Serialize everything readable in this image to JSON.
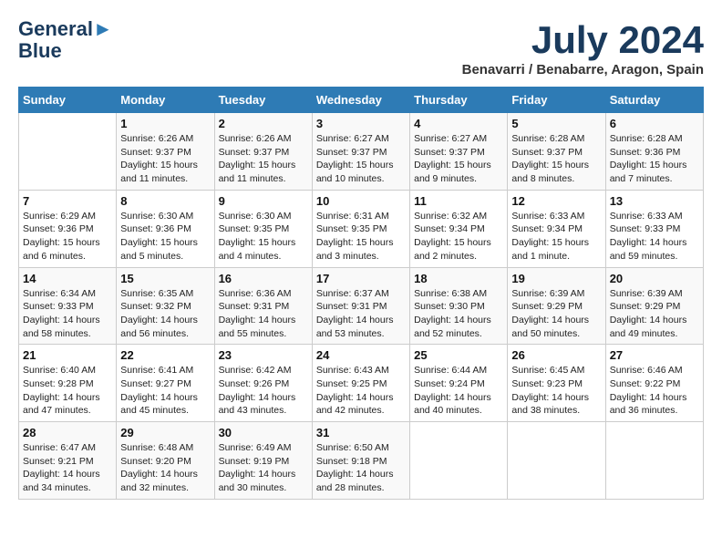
{
  "header": {
    "logo_line1": "General",
    "logo_line2": "Blue",
    "month_title": "July 2024",
    "subtitle": "Benavarri / Benabarre, Aragon, Spain"
  },
  "days_of_week": [
    "Sunday",
    "Monday",
    "Tuesday",
    "Wednesday",
    "Thursday",
    "Friday",
    "Saturday"
  ],
  "weeks": [
    [
      {
        "day": "",
        "sunrise": "",
        "sunset": "",
        "daylight": ""
      },
      {
        "day": "1",
        "sunrise": "Sunrise: 6:26 AM",
        "sunset": "Sunset: 9:37 PM",
        "daylight": "Daylight: 15 hours and 11 minutes."
      },
      {
        "day": "2",
        "sunrise": "Sunrise: 6:26 AM",
        "sunset": "Sunset: 9:37 PM",
        "daylight": "Daylight: 15 hours and 11 minutes."
      },
      {
        "day": "3",
        "sunrise": "Sunrise: 6:27 AM",
        "sunset": "Sunset: 9:37 PM",
        "daylight": "Daylight: 15 hours and 10 minutes."
      },
      {
        "day": "4",
        "sunrise": "Sunrise: 6:27 AM",
        "sunset": "Sunset: 9:37 PM",
        "daylight": "Daylight: 15 hours and 9 minutes."
      },
      {
        "day": "5",
        "sunrise": "Sunrise: 6:28 AM",
        "sunset": "Sunset: 9:37 PM",
        "daylight": "Daylight: 15 hours and 8 minutes."
      },
      {
        "day": "6",
        "sunrise": "Sunrise: 6:28 AM",
        "sunset": "Sunset: 9:36 PM",
        "daylight": "Daylight: 15 hours and 7 minutes."
      }
    ],
    [
      {
        "day": "7",
        "sunrise": "Sunrise: 6:29 AM",
        "sunset": "Sunset: 9:36 PM",
        "daylight": "Daylight: 15 hours and 6 minutes."
      },
      {
        "day": "8",
        "sunrise": "Sunrise: 6:30 AM",
        "sunset": "Sunset: 9:36 PM",
        "daylight": "Daylight: 15 hours and 5 minutes."
      },
      {
        "day": "9",
        "sunrise": "Sunrise: 6:30 AM",
        "sunset": "Sunset: 9:35 PM",
        "daylight": "Daylight: 15 hours and 4 minutes."
      },
      {
        "day": "10",
        "sunrise": "Sunrise: 6:31 AM",
        "sunset": "Sunset: 9:35 PM",
        "daylight": "Daylight: 15 hours and 3 minutes."
      },
      {
        "day": "11",
        "sunrise": "Sunrise: 6:32 AM",
        "sunset": "Sunset: 9:34 PM",
        "daylight": "Daylight: 15 hours and 2 minutes."
      },
      {
        "day": "12",
        "sunrise": "Sunrise: 6:33 AM",
        "sunset": "Sunset: 9:34 PM",
        "daylight": "Daylight: 15 hours and 1 minute."
      },
      {
        "day": "13",
        "sunrise": "Sunrise: 6:33 AM",
        "sunset": "Sunset: 9:33 PM",
        "daylight": "Daylight: 14 hours and 59 minutes."
      }
    ],
    [
      {
        "day": "14",
        "sunrise": "Sunrise: 6:34 AM",
        "sunset": "Sunset: 9:33 PM",
        "daylight": "Daylight: 14 hours and 58 minutes."
      },
      {
        "day": "15",
        "sunrise": "Sunrise: 6:35 AM",
        "sunset": "Sunset: 9:32 PM",
        "daylight": "Daylight: 14 hours and 56 minutes."
      },
      {
        "day": "16",
        "sunrise": "Sunrise: 6:36 AM",
        "sunset": "Sunset: 9:31 PM",
        "daylight": "Daylight: 14 hours and 55 minutes."
      },
      {
        "day": "17",
        "sunrise": "Sunrise: 6:37 AM",
        "sunset": "Sunset: 9:31 PM",
        "daylight": "Daylight: 14 hours and 53 minutes."
      },
      {
        "day": "18",
        "sunrise": "Sunrise: 6:38 AM",
        "sunset": "Sunset: 9:30 PM",
        "daylight": "Daylight: 14 hours and 52 minutes."
      },
      {
        "day": "19",
        "sunrise": "Sunrise: 6:39 AM",
        "sunset": "Sunset: 9:29 PM",
        "daylight": "Daylight: 14 hours and 50 minutes."
      },
      {
        "day": "20",
        "sunrise": "Sunrise: 6:39 AM",
        "sunset": "Sunset: 9:29 PM",
        "daylight": "Daylight: 14 hours and 49 minutes."
      }
    ],
    [
      {
        "day": "21",
        "sunrise": "Sunrise: 6:40 AM",
        "sunset": "Sunset: 9:28 PM",
        "daylight": "Daylight: 14 hours and 47 minutes."
      },
      {
        "day": "22",
        "sunrise": "Sunrise: 6:41 AM",
        "sunset": "Sunset: 9:27 PM",
        "daylight": "Daylight: 14 hours and 45 minutes."
      },
      {
        "day": "23",
        "sunrise": "Sunrise: 6:42 AM",
        "sunset": "Sunset: 9:26 PM",
        "daylight": "Daylight: 14 hours and 43 minutes."
      },
      {
        "day": "24",
        "sunrise": "Sunrise: 6:43 AM",
        "sunset": "Sunset: 9:25 PM",
        "daylight": "Daylight: 14 hours and 42 minutes."
      },
      {
        "day": "25",
        "sunrise": "Sunrise: 6:44 AM",
        "sunset": "Sunset: 9:24 PM",
        "daylight": "Daylight: 14 hours and 40 minutes."
      },
      {
        "day": "26",
        "sunrise": "Sunrise: 6:45 AM",
        "sunset": "Sunset: 9:23 PM",
        "daylight": "Daylight: 14 hours and 38 minutes."
      },
      {
        "day": "27",
        "sunrise": "Sunrise: 6:46 AM",
        "sunset": "Sunset: 9:22 PM",
        "daylight": "Daylight: 14 hours and 36 minutes."
      }
    ],
    [
      {
        "day": "28",
        "sunrise": "Sunrise: 6:47 AM",
        "sunset": "Sunset: 9:21 PM",
        "daylight": "Daylight: 14 hours and 34 minutes."
      },
      {
        "day": "29",
        "sunrise": "Sunrise: 6:48 AM",
        "sunset": "Sunset: 9:20 PM",
        "daylight": "Daylight: 14 hours and 32 minutes."
      },
      {
        "day": "30",
        "sunrise": "Sunrise: 6:49 AM",
        "sunset": "Sunset: 9:19 PM",
        "daylight": "Daylight: 14 hours and 30 minutes."
      },
      {
        "day": "31",
        "sunrise": "Sunrise: 6:50 AM",
        "sunset": "Sunset: 9:18 PM",
        "daylight": "Daylight: 14 hours and 28 minutes."
      },
      {
        "day": "",
        "sunrise": "",
        "sunset": "",
        "daylight": ""
      },
      {
        "day": "",
        "sunrise": "",
        "sunset": "",
        "daylight": ""
      },
      {
        "day": "",
        "sunrise": "",
        "sunset": "",
        "daylight": ""
      }
    ]
  ]
}
